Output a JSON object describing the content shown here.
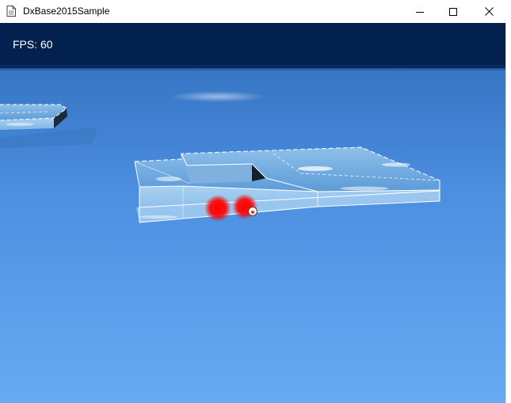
{
  "window": {
    "title": "DxBase2015Sample",
    "icon": "document-icon",
    "controls": {
      "minimize_icon": "minimize-icon",
      "maximize_icon": "maximize-icon",
      "close_icon": "close-icon"
    }
  },
  "hud": {
    "fps_text": "FPS: 60"
  },
  "scene": {
    "objects": [
      "floating-platform-left",
      "floating-platform-main",
      "red-glow-marker",
      "ball-player"
    ],
    "colors": {
      "sky_top": "#02214e",
      "sky_gradient_top": "#2f6fb5",
      "sky_gradient_bottom": "#67aaf2",
      "glow": "#ff0000"
    }
  }
}
